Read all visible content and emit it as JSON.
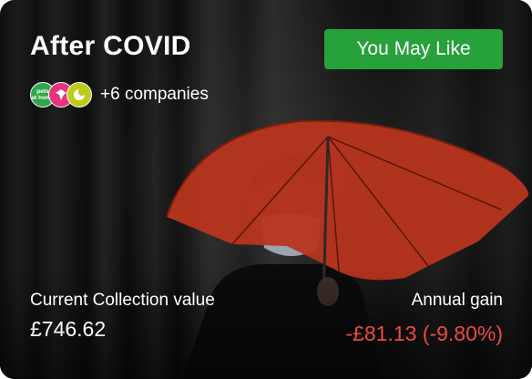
{
  "card": {
    "title": "After COVID",
    "cta_label": "You May Like",
    "companies_text": "+6 companies",
    "logos": [
      {
        "name": "pets-at-home-logo",
        "text": "pets\nat home",
        "color": "#2ea84a"
      },
      {
        "name": "tourism-logo",
        "text": "",
        "color": "#e6337d"
      },
      {
        "name": "zoo-logo",
        "text": "",
        "color": "#bccc1a"
      }
    ],
    "collection_label": "Current Collection value",
    "collection_value": "£746.62",
    "gain_label": "Annual gain",
    "gain_value": "-£81.13 (-9.80%)"
  },
  "colors": {
    "cta_green": "#27a13a",
    "loss_red": "#ee4a47"
  }
}
